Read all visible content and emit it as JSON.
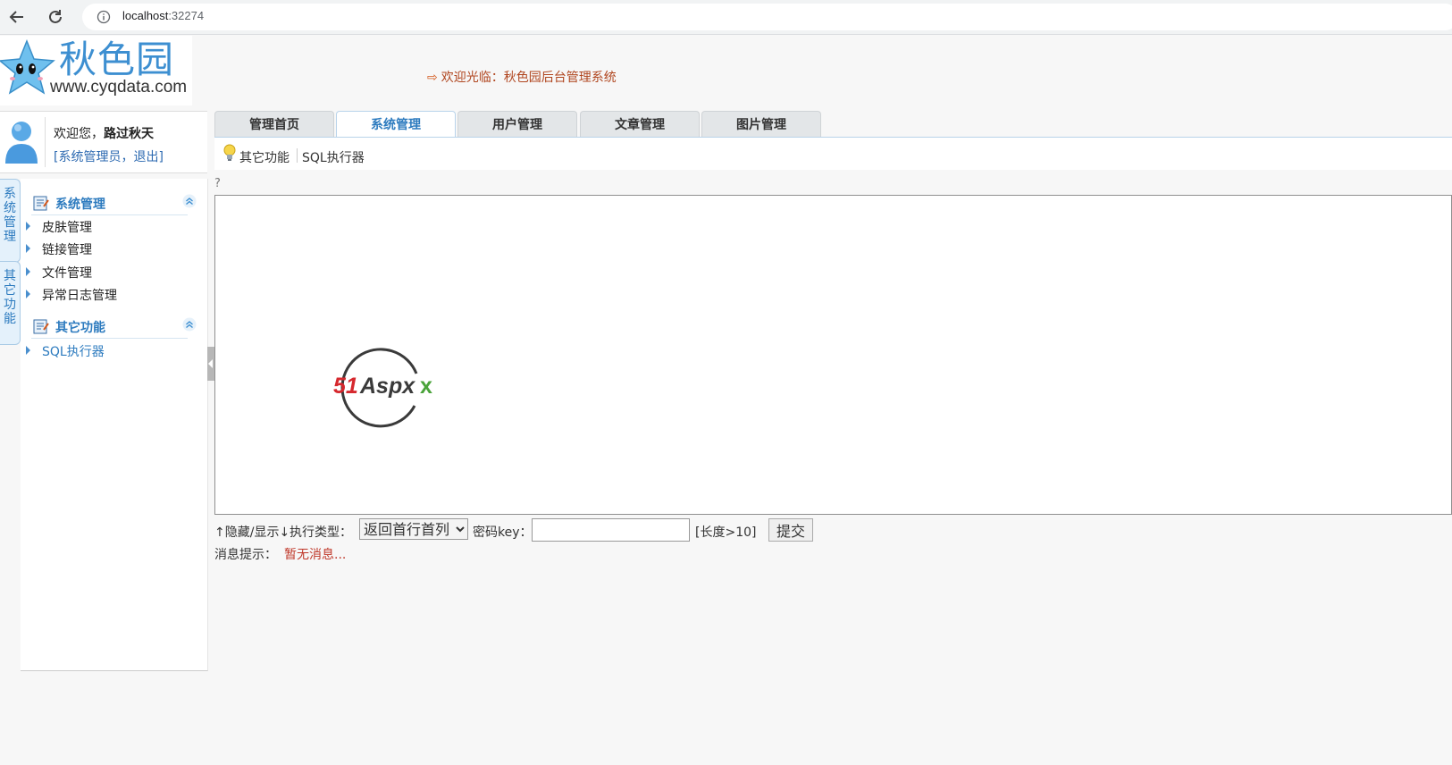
{
  "browser": {
    "url_host": "localhost",
    "url_port": ":32274"
  },
  "header": {
    "logo_cn": "秋色园",
    "logo_url": "www.cyqdata.com",
    "welcome": "欢迎光临：秋色园后台管理系统"
  },
  "user": {
    "greeting_prefix": "欢迎您，",
    "name": "路过秋天",
    "role_link": "[系统管理员，",
    "logout_link": "退出]"
  },
  "side_tabs": [
    "系统管理",
    "其它功能"
  ],
  "menu": {
    "sections": [
      {
        "title": "系统管理",
        "items": [
          "皮肤管理",
          "链接管理",
          "文件管理",
          "异常日志管理"
        ]
      },
      {
        "title": "其它功能",
        "items": [
          "SQL执行器"
        ]
      }
    ]
  },
  "tabs": [
    "管理首页",
    "系统管理",
    "用户管理",
    "文章管理",
    "图片管理"
  ],
  "active_tab": "系统管理",
  "breadcrumb": {
    "section": "其它功能",
    "current": "SQL执行器"
  },
  "question_mark": "?",
  "sql_text": "",
  "controls": {
    "toggle_label": "↑隐藏/显示↓",
    "exec_type_label": "执行类型：",
    "exec_type_value": "返回首行首列",
    "key_label": "密码key：",
    "key_value": "",
    "length_hint": "[长度>10]",
    "submit_label": "提交"
  },
  "message": {
    "label": "消息提示：",
    "value": "暂无消息..."
  },
  "colors": {
    "accent_blue": "#2d7bbf",
    "welcome_text": "#b0461f",
    "message_red": "#c0392b"
  }
}
